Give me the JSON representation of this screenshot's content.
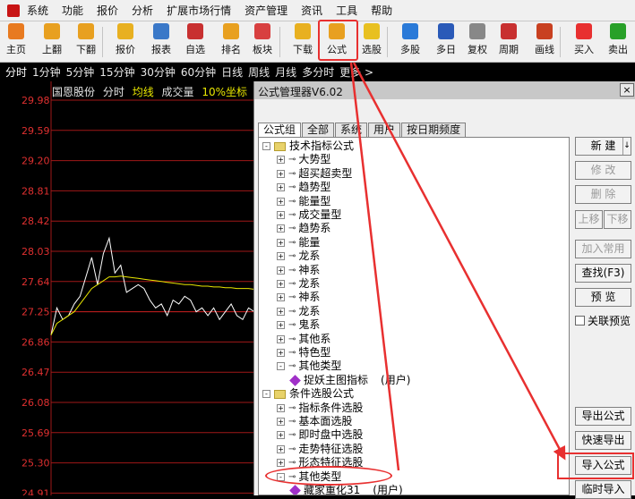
{
  "menubar": {
    "items": [
      "系统",
      "功能",
      "报价",
      "分析",
      "扩展市场行情",
      "资产管理",
      "资讯",
      "工具",
      "帮助"
    ]
  },
  "toolbar": {
    "buttons": [
      {
        "label": "主页",
        "icon": "home-icon",
        "color": "#e87a20"
      },
      {
        "label": "上翻",
        "icon": "arrow-up-icon",
        "color": "#e8a020"
      },
      {
        "label": "下翻",
        "icon": "arrow-down-icon",
        "color": "#e8a020"
      },
      {
        "label": "报价",
        "icon": "yen-icon",
        "color": "#e8b020"
      },
      {
        "label": "报表",
        "icon": "report-icon",
        "color": "#3a78c8"
      },
      {
        "label": "自选",
        "icon": "f6-icon",
        "color": "#c83030"
      },
      {
        "label": "排名",
        "icon": "rank-icon",
        "color": "#e8a020"
      },
      {
        "label": "板块",
        "icon": "sector-icon",
        "color": "#d84040"
      },
      {
        "label": "下载",
        "icon": "download-icon",
        "color": "#e8b020"
      },
      {
        "label": "公式",
        "icon": "formula-icon",
        "color": "#e8a020"
      },
      {
        "label": "选股",
        "icon": "stock-select-icon",
        "color": "#e8c020"
      },
      {
        "label": "多股",
        "icon": "multi-stock-icon",
        "color": "#2a7ad8"
      },
      {
        "label": "多日",
        "icon": "multi-day-icon",
        "color": "#2a5ab8"
      },
      {
        "label": "复权",
        "icon": "restore-icon",
        "color": "#888888"
      },
      {
        "label": "周期",
        "icon": "f8-icon",
        "color": "#c83030"
      },
      {
        "label": "画线",
        "icon": "draw-line-icon",
        "color": "#c84020"
      },
      {
        "label": "买入",
        "icon": "buy-icon",
        "color": "#e83030"
      },
      {
        "label": "卖出",
        "icon": "sell-icon",
        "color": "#28a028"
      }
    ]
  },
  "periodbar": {
    "items": [
      "分时",
      "1分钟",
      "5分钟",
      "15分钟",
      "30分钟",
      "60分钟",
      "日线",
      "周线",
      "月线",
      "多分时",
      "更多 >"
    ]
  },
  "chart": {
    "stock_name": "国恩股份",
    "mode": "分时",
    "ma_label": "均线",
    "volume_label": "成交量",
    "coord_label": "10%坐标",
    "price_levels": [
      "29.98",
      "29.59",
      "29.20",
      "28.81",
      "28.42",
      "28.03",
      "27.64",
      "27.25",
      "26.86",
      "26.47",
      "26.08",
      "25.69",
      "25.30",
      "24.91"
    ]
  },
  "chart_data": {
    "type": "line",
    "y_ticks": [
      29.98,
      29.59,
      29.2,
      28.81,
      28.42,
      28.03,
      27.64,
      27.25,
      26.86,
      26.47,
      26.08,
      25.69,
      25.3,
      24.91
    ],
    "ylim": [
      24.91,
      29.98
    ],
    "series": [
      {
        "color": "#ffffff",
        "values": [
          26.95,
          27.3,
          27.15,
          27.2,
          27.35,
          27.45,
          27.7,
          27.95,
          27.6,
          28.0,
          28.2,
          27.75,
          27.85,
          27.5,
          27.55,
          27.6,
          27.55,
          27.4,
          27.3,
          27.35,
          27.2,
          27.4,
          27.35,
          27.45,
          27.4,
          27.25,
          27.3,
          27.2,
          27.3,
          27.15,
          27.25,
          27.35,
          27.2,
          27.15,
          27.3,
          27.25
        ]
      },
      {
        "color": "#e8e600",
        "values": [
          26.95,
          27.1,
          27.15,
          27.2,
          27.25,
          27.35,
          27.45,
          27.55,
          27.6,
          27.65,
          27.7,
          27.7,
          27.71,
          27.7,
          27.69,
          27.68,
          27.67,
          27.66,
          27.65,
          27.64,
          27.63,
          27.62,
          27.61,
          27.6,
          27.6,
          27.59,
          27.58,
          27.58,
          27.57,
          27.57,
          27.56,
          27.56,
          27.55,
          27.55,
          27.55,
          27.54
        ]
      }
    ]
  },
  "dialog": {
    "title": "公式管理器V6.02",
    "close": "×",
    "tabs": [
      "公式组",
      "全部",
      "系统",
      "用户",
      "按日期频度"
    ],
    "tree": [
      {
        "level": 0,
        "type": "folder",
        "toggle": "-",
        "label": "技术指标公式"
      },
      {
        "level": 1,
        "type": "key",
        "toggle": "+",
        "label": "大势型"
      },
      {
        "level": 1,
        "type": "key",
        "toggle": "+",
        "label": "超买超卖型"
      },
      {
        "level": 1,
        "type": "key",
        "toggle": "+",
        "label": "趋势型"
      },
      {
        "level": 1,
        "type": "key",
        "toggle": "+",
        "label": "能量型"
      },
      {
        "level": 1,
        "type": "key",
        "toggle": "+",
        "label": "成交量型"
      },
      {
        "level": 1,
        "type": "key",
        "toggle": "+",
        "label": "趋势系"
      },
      {
        "level": 1,
        "type": "key",
        "toggle": "+",
        "label": "能量"
      },
      {
        "level": 1,
        "type": "key",
        "toggle": "+",
        "label": "龙系"
      },
      {
        "level": 1,
        "type": "key",
        "toggle": "+",
        "label": "神系"
      },
      {
        "level": 1,
        "type": "key",
        "toggle": "+",
        "label": "龙系"
      },
      {
        "level": 1,
        "type": "key",
        "toggle": "+",
        "label": "神系"
      },
      {
        "level": 1,
        "type": "key",
        "toggle": "+",
        "label": "龙系"
      },
      {
        "level": 1,
        "type": "key",
        "toggle": "+",
        "label": "鬼系"
      },
      {
        "level": 1,
        "type": "key",
        "toggle": "+",
        "label": "其他系"
      },
      {
        "level": 1,
        "type": "key",
        "toggle": "+",
        "label": "特色型"
      },
      {
        "level": 1,
        "type": "key",
        "toggle": "-",
        "label": "其他类型"
      },
      {
        "level": 2,
        "type": "item",
        "label": "捉妖主图指标",
        "tag": "(用户)"
      },
      {
        "level": 0,
        "type": "folder",
        "toggle": "-",
        "label": "条件选股公式"
      },
      {
        "level": 1,
        "type": "key",
        "toggle": "+",
        "label": "指标条件选股"
      },
      {
        "level": 1,
        "type": "key",
        "toggle": "+",
        "label": "基本面选股"
      },
      {
        "level": 1,
        "type": "key",
        "toggle": "+",
        "label": "即时盘中选股"
      },
      {
        "level": 1,
        "type": "key",
        "toggle": "+",
        "label": "走势特征选股"
      },
      {
        "level": 1,
        "type": "key",
        "toggle": "+",
        "label": "形态特征选股"
      },
      {
        "level": 1,
        "type": "key",
        "toggle": "-",
        "label": "其他类型"
      },
      {
        "level": 2,
        "type": "item",
        "label": "藏家重化31",
        "tag": "(用户)"
      }
    ],
    "buttons": {
      "new": "新 建",
      "new_arrow": "↓",
      "modify": "修 改",
      "delete": "删 除",
      "move_up": "上移",
      "move_down": "下移",
      "add_common": "加入常用",
      "find": "查找(F3)",
      "preview": "预 览",
      "linked_preview": "关联预览",
      "export": "导出公式",
      "quick_export": "快速导出",
      "import": "导入公式",
      "temp_import": "临时导入"
    }
  },
  "colors": {
    "accent_red": "#e83030",
    "grid_red": "#a01818",
    "ma_yellow": "#e8e600"
  }
}
